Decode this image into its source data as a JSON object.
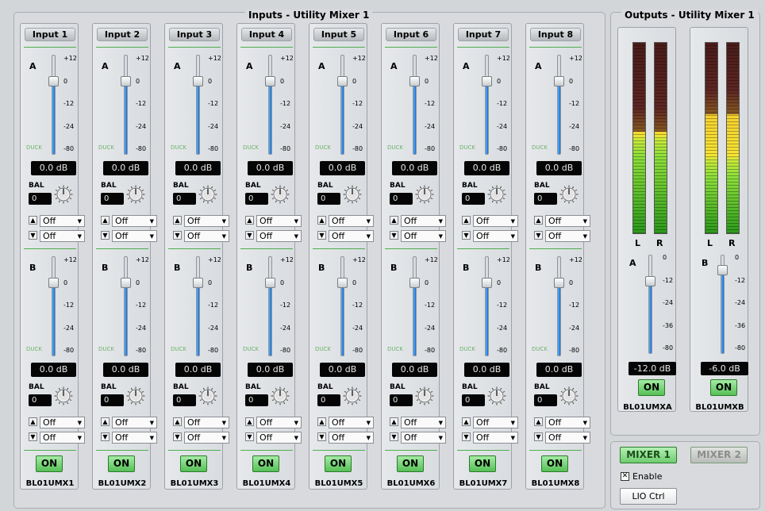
{
  "inputs_group": {
    "title": "Inputs - Utility Mixer 1"
  },
  "outputs_group": {
    "title": "Outputs - Utility Mixer 1"
  },
  "input_strips": [
    {
      "label": "Input 1",
      "name": "BL01UMX1",
      "on_label": "ON"
    },
    {
      "label": "Input 2",
      "name": "BL01UMX2",
      "on_label": "ON"
    },
    {
      "label": "Input 3",
      "name": "BL01UMX3",
      "on_label": "ON"
    },
    {
      "label": "Input 4",
      "name": "BL01UMX4",
      "on_label": "ON"
    },
    {
      "label": "Input 5",
      "name": "BL01UMX5",
      "on_label": "ON"
    },
    {
      "label": "Input 6",
      "name": "BL01UMX6",
      "on_label": "ON"
    },
    {
      "label": "Input 7",
      "name": "BL01UMX7",
      "on_label": "ON"
    },
    {
      "label": "Input 8",
      "name": "BL01UMX8",
      "on_label": "ON"
    }
  ],
  "channel": {
    "a_label": "A",
    "b_label": "B",
    "duck_label": "DUCK",
    "scale": [
      "+12",
      "0",
      "-12",
      "-24",
      "-80"
    ],
    "level_text": "0.0 dB",
    "bal_label": "BAL",
    "bal_value": "0",
    "up_arrow": "▲",
    "down_arrow": "▼",
    "off_option": "Off",
    "dd_caret": "▼"
  },
  "output_strips": [
    {
      "name": "BL01UMXA",
      "label": "A",
      "level_text": "-12.0 dB",
      "on_label": "ON",
      "meter_level": 0.53
    },
    {
      "name": "BL01UMXB",
      "label": "B",
      "level_text": "-6.0 dB",
      "on_label": "ON",
      "meter_level": 0.62
    }
  ],
  "output_channel": {
    "l_label": "L",
    "r_label": "R",
    "scale": [
      "0",
      "-12",
      "-24",
      "-36",
      "-80"
    ]
  },
  "mixer_buttons": {
    "mixer1": "MIXER 1",
    "mixer2": "MIXER 2",
    "enable_label": "Enable",
    "enable_check": "✕",
    "lio_ctrl": "LIO Ctrl"
  },
  "colors": {
    "on_green": "#56c056",
    "fader_blue": "#1a6fd8",
    "meter_green": "#5fd13a",
    "meter_yellow": "#f5e332",
    "meter_red": "#5e2622"
  }
}
